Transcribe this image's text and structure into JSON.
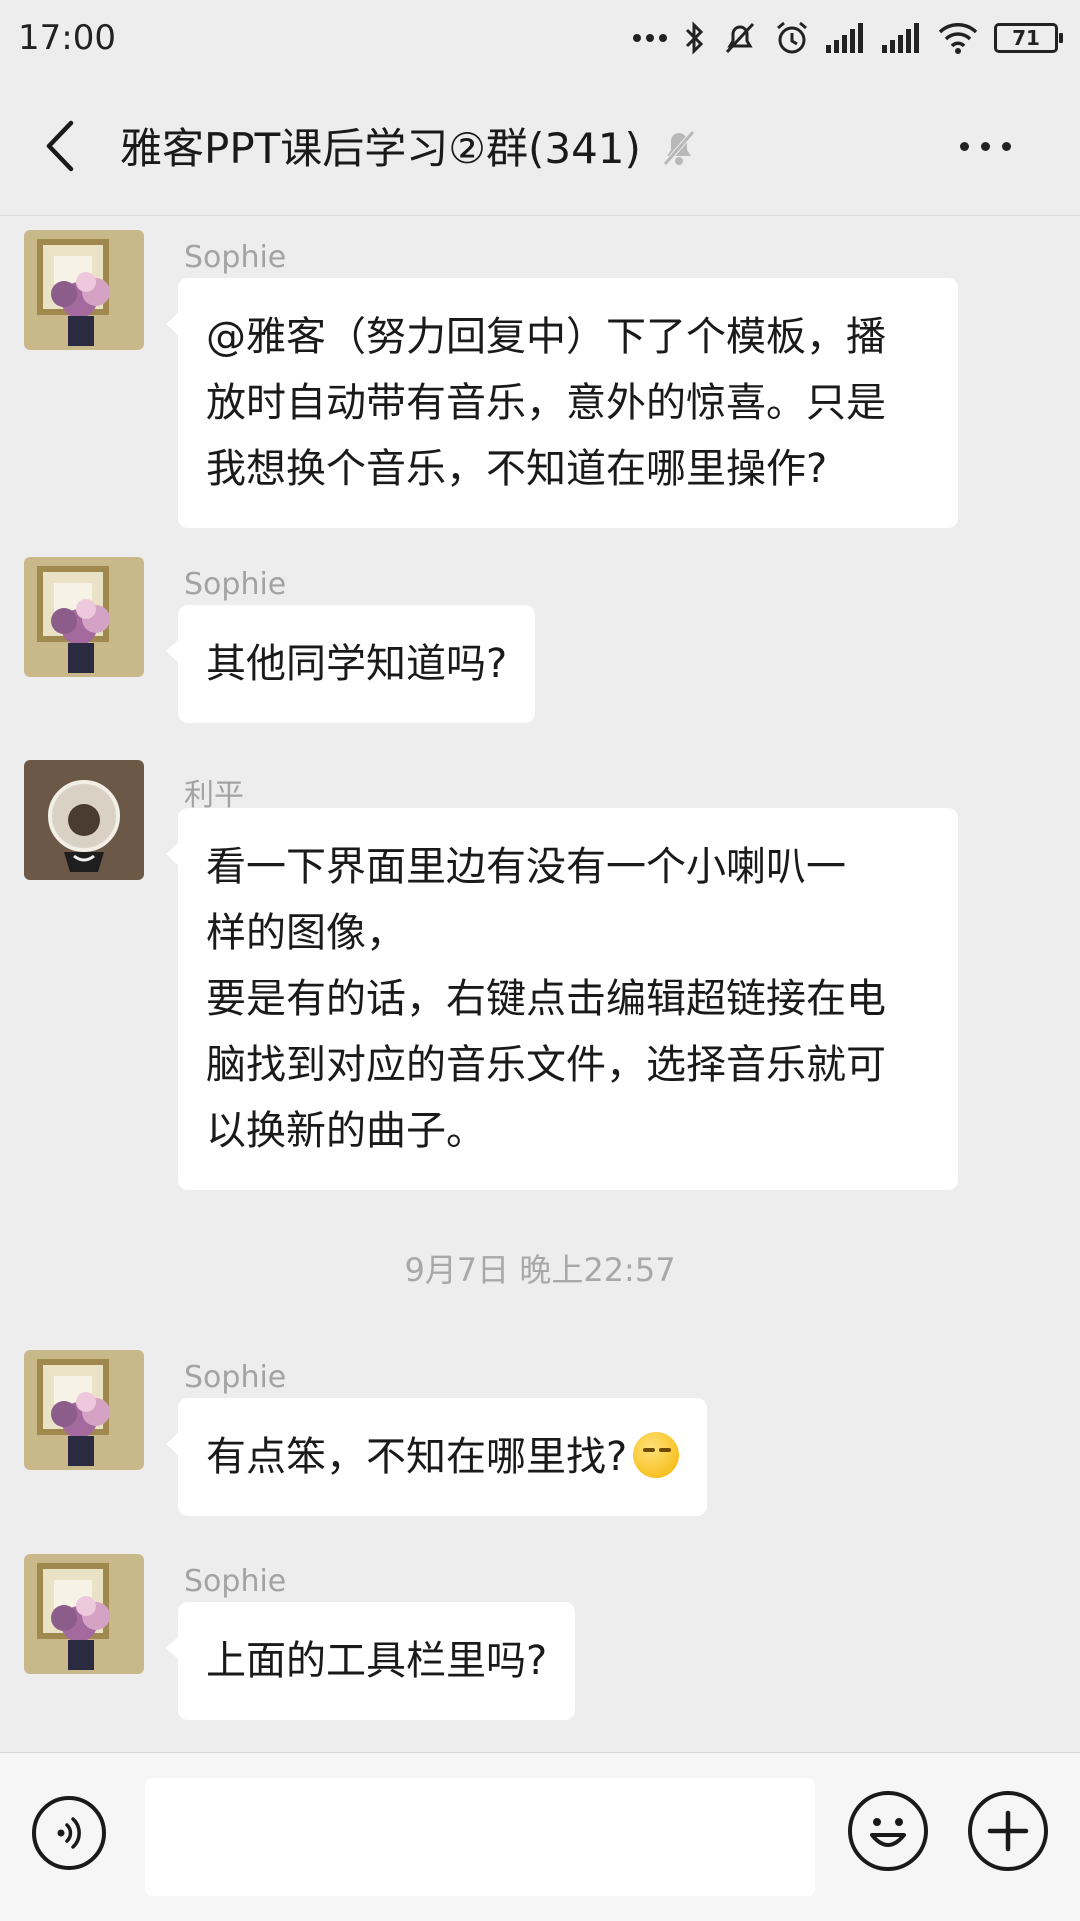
{
  "status_bar": {
    "time": "17:00",
    "battery": "71",
    "icons": [
      "more-dots-icon",
      "bluetooth-icon",
      "silent-bell-icon",
      "alarm-icon",
      "signal-icon",
      "signal-icon",
      "wifi-icon",
      "battery-icon"
    ]
  },
  "header": {
    "back_icon": "chevron-left-icon",
    "title": "雅客PPT课后学习②群(341)",
    "mute_icon": "bell-muted-icon",
    "more_icon": "more-dots-icon"
  },
  "messages": [
    {
      "sender": "Sophie",
      "lines": [
        "@雅客（努力回复中）下了个模板，播",
        "放时自动带有音乐，意外的惊喜。只是",
        "我想换个音乐，不知道在哪里操作?"
      ]
    },
    {
      "sender": "Sophie",
      "lines": [
        "其他同学知道吗?"
      ]
    },
    {
      "sender": "利平",
      "lines": [
        "看一下界面里边有没有一个小喇叭一",
        "样的图像，",
        "要是有的话，右键点击编辑超链接在电",
        "脑找到对应的音乐文件，选择音乐就可",
        "以换新的曲子。"
      ]
    },
    {
      "sender": "Sophie",
      "lines": [
        "有点笨，不知在哪里找?"
      ],
      "emoji": "smirk-emoji"
    },
    {
      "sender": "Sophie",
      "lines": [
        "上面的工具栏里吗?"
      ]
    }
  ],
  "timestamp": "9月7日 晚上22:57",
  "input_bar": {
    "voice_icon": "voice-icon",
    "input_value": "",
    "emoji_icon": "emoji-icon",
    "plus_icon": "plus-icon"
  }
}
